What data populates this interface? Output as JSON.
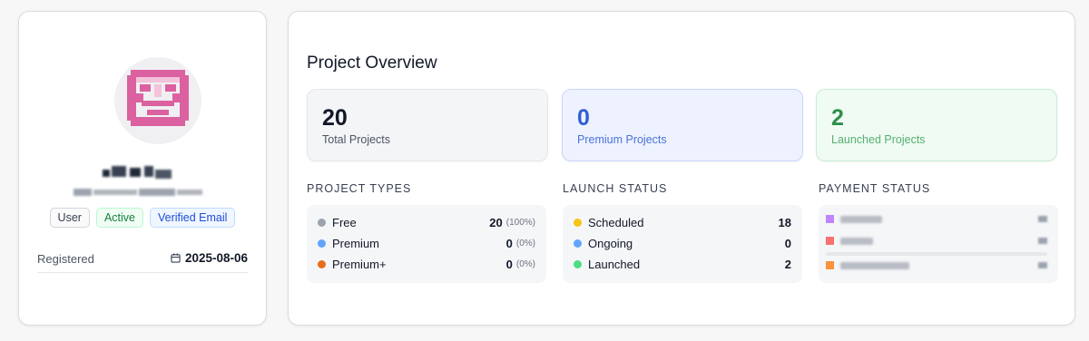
{
  "profile": {
    "name": "",
    "email": "",
    "badges": {
      "role": "User",
      "status": "Active",
      "verification": "Verified Email"
    },
    "registered": {
      "label": "Registered",
      "date": "2025-08-06",
      "icon": "calendar-icon"
    },
    "avatar_colors": {
      "primary": "#d9559b",
      "background": "#f0f0f2"
    }
  },
  "overview": {
    "title": "Project Overview",
    "stats": [
      {
        "value": "20",
        "label": "Total Projects",
        "color": "#111827"
      },
      {
        "value": "0",
        "label": "Premium Projects",
        "color": "#2f5fd6"
      },
      {
        "value": "2",
        "label": "Launched Projects",
        "color": "#2f8f4a"
      }
    ],
    "project_types": {
      "heading": "PROJECT TYPES",
      "items": [
        {
          "label": "Free",
          "value": "20",
          "pct": "(100%)",
          "color": "#9ca3af"
        },
        {
          "label": "Premium",
          "value": "0",
          "pct": "(0%)",
          "color": "#60a5fa"
        },
        {
          "label": "Premium+",
          "value": "0",
          "pct": "(0%)",
          "color": "#ea6c1a"
        }
      ]
    },
    "launch_status": {
      "heading": "LAUNCH STATUS",
      "items": [
        {
          "label": "Scheduled",
          "value": "18",
          "color": "#f5c518"
        },
        {
          "label": "Ongoing",
          "value": "0",
          "color": "#60a5fa"
        },
        {
          "label": "Launched",
          "value": "2",
          "color": "#4ade80"
        }
      ]
    },
    "payment_status": {
      "heading": "PAYMENT STATUS",
      "items": [
        {
          "color": "#c084fc"
        },
        {
          "color": "#f87171"
        },
        {
          "color": "#fb923c"
        }
      ]
    }
  }
}
